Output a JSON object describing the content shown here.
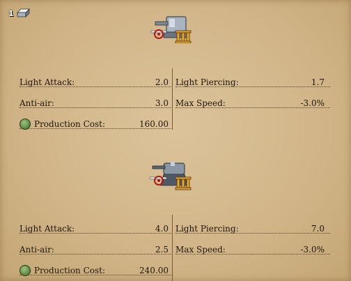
{
  "header": {
    "steel_count": "1",
    "resource_icon": "steel-ingot-icon"
  },
  "units": [
    {
      "icon": "naval-gun-turret-icon",
      "tier": "III",
      "stats": {
        "light_attack": {
          "label": "Light Attack:",
          "value": "2.0"
        },
        "light_piercing": {
          "label": "Light Piercing:",
          "value": "1.7"
        },
        "anti_air": {
          "label": "Anti-air:",
          "value": "3.0"
        },
        "max_speed": {
          "label": "Max Speed:",
          "value": "-3.0%"
        },
        "production_cost": {
          "label": "Production Cost:",
          "value": "160.00"
        }
      }
    },
    {
      "icon": "anti-air-gun-mount-icon",
      "tier": "III",
      "stats": {
        "light_attack": {
          "label": "Light Attack:",
          "value": "4.0"
        },
        "light_piercing": {
          "label": "Light Piercing:",
          "value": "7.0"
        },
        "anti_air": {
          "label": "Anti-air:",
          "value": "2.5"
        },
        "max_speed": {
          "label": "Max Speed:",
          "value": "-3.0%"
        },
        "production_cost": {
          "label": "Production Cost:",
          "value": "240.00"
        }
      }
    }
  ],
  "colors": {
    "parchment": "#d2b68a",
    "tier_gold": "#e0a82a",
    "text": "#1f1608"
  }
}
